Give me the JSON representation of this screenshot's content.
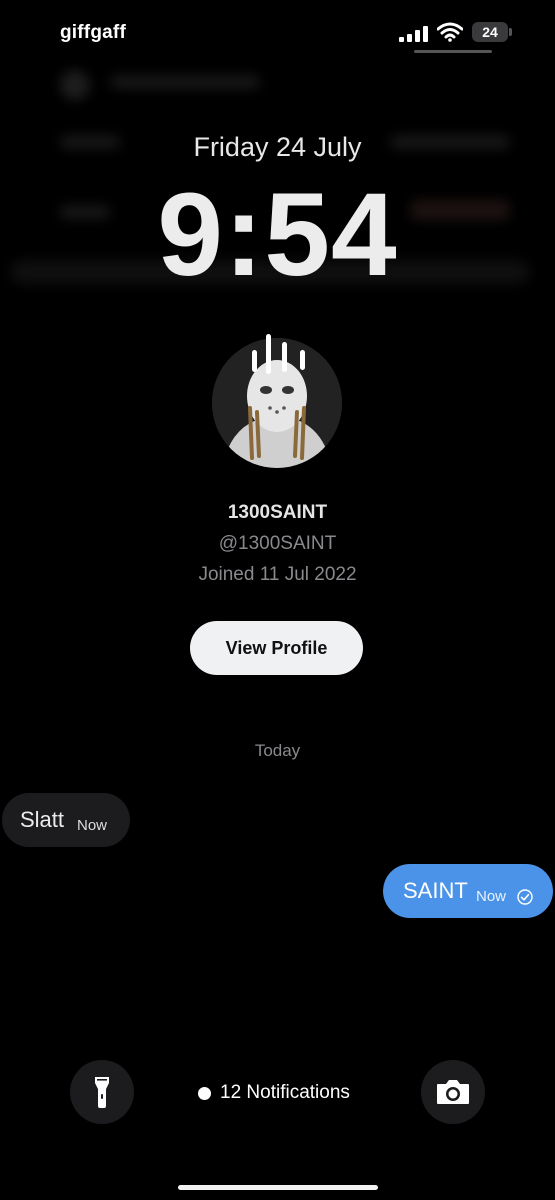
{
  "status_bar": {
    "carrier": "giffgaff",
    "battery": "24"
  },
  "lock_screen": {
    "date": "Friday 24 July",
    "time": "9:54"
  },
  "profile": {
    "name": "1300SAINT",
    "handle": "@1300SAINT",
    "joined": "Joined 11 Jul 2022",
    "view_profile_label": "View Profile"
  },
  "conversation": {
    "day_label": "Today",
    "messages": [
      {
        "direction": "incoming",
        "text": "Slatt",
        "time": "Now"
      },
      {
        "direction": "outgoing",
        "text": "SAINT",
        "time": "Now",
        "status": "read-check-icon"
      }
    ]
  },
  "bottom_bar": {
    "notifications_label": "12 Notifications",
    "left_button_icon": "flashlight-icon",
    "right_button_icon": "camera-icon"
  },
  "colors": {
    "background": "#000000",
    "outgoing_bubble": "#4a93e8",
    "incoming_bubble": "#1c1c1e",
    "button_light": "#eff1f2"
  }
}
